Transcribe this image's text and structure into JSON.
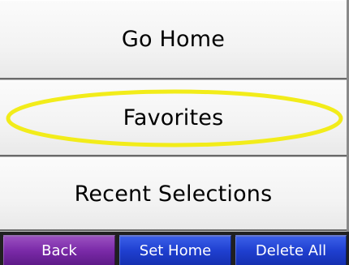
{
  "menu": {
    "items": [
      {
        "label": "Go Home"
      },
      {
        "label": "Favorites",
        "highlighted": true
      },
      {
        "label": "Recent Selections"
      }
    ]
  },
  "softkeys": {
    "back": "Back",
    "set_home": "Set Home",
    "delete_all": "Delete All"
  },
  "colors": {
    "highlight_ring": "#f2ec1a",
    "back_button": "#7a2aa8",
    "action_button": "#1f3fd0",
    "menu_background": "#f4f4f4"
  }
}
